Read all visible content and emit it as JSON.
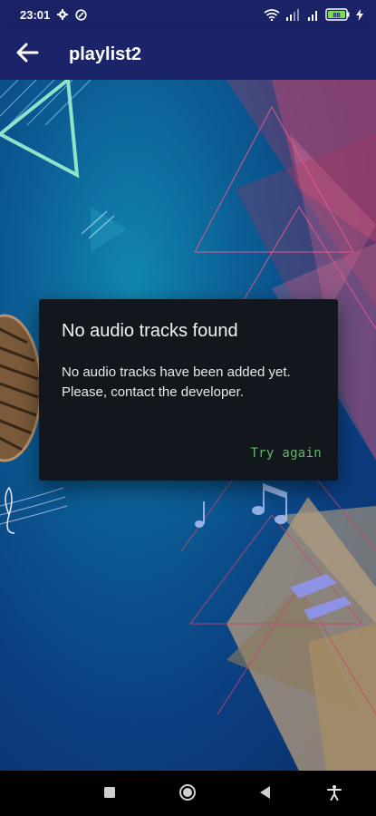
{
  "status_bar": {
    "time": "23:01",
    "battery": "88"
  },
  "app_bar": {
    "title": "playlist2"
  },
  "dialog": {
    "title": "No audio tracks found",
    "message": "No audio tracks have been added yet. Please, contact the developer.",
    "action_label": "Try again"
  },
  "nav_bar": {
    "icons": [
      "recents-square-icon",
      "home-circle-icon",
      "back-triangle-icon",
      "accessibility-icon"
    ]
  },
  "colors": {
    "status_bar": "#1a2366",
    "app_bar": "#1b2468",
    "dialog_bg": "#11171c",
    "action_text": "#63b86c"
  }
}
